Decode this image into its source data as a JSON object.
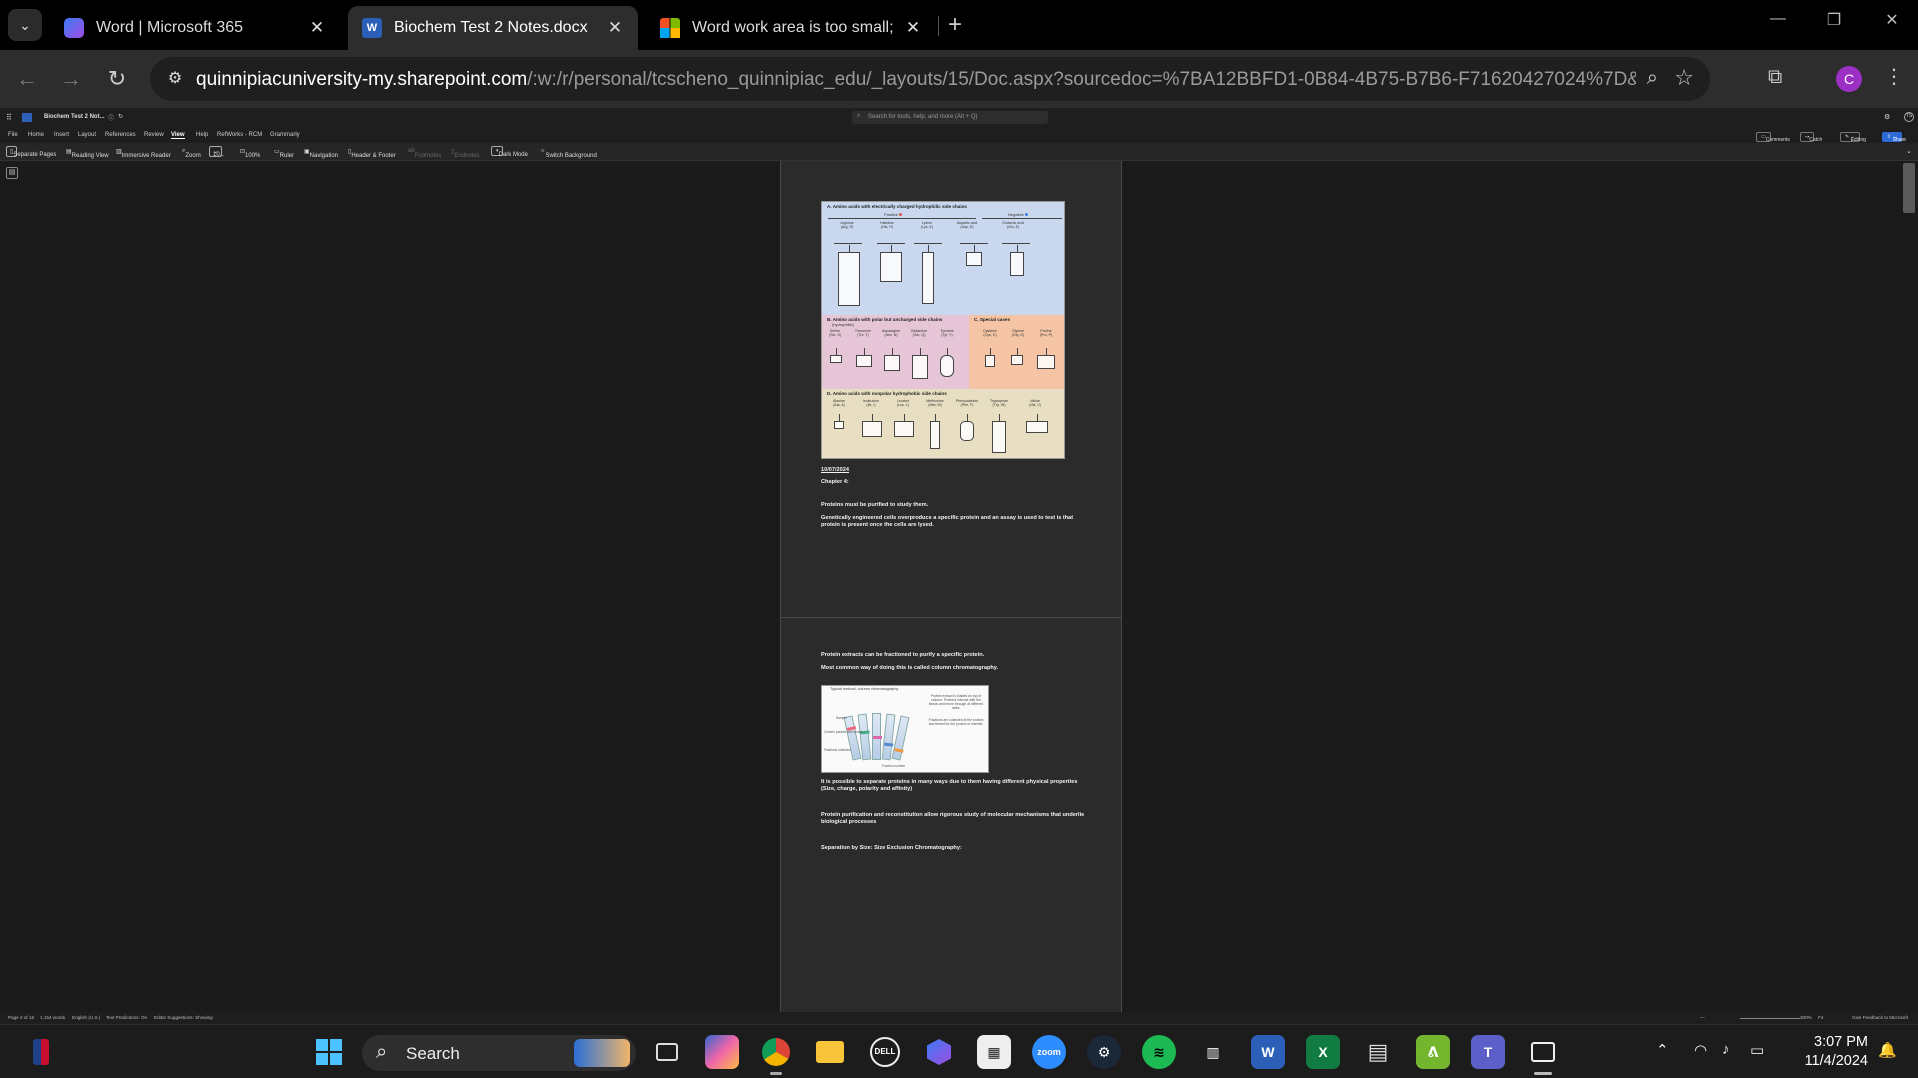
{
  "browser": {
    "tabs": [
      {
        "title": "Word | Microsoft 365",
        "active": false
      },
      {
        "title": "Biochem Test 2 Notes.docx",
        "active": true
      },
      {
        "title": "Word work area is too small; ho",
        "active": false
      }
    ],
    "url_host": "quinnipiacuniversity-my.sharepoint.com",
    "url_path": "/:w:/r/personal/tcscheno_quinnipiac_edu/_layouts/15/Doc.aspx?sourcedoc=%7BA12BBFD1-0B84-4B75-B7B6-F71620427024%7D&file=Biochem%2...",
    "profile_initial": "C"
  },
  "word": {
    "doc_name": "Biochem Test 2 Not...",
    "search_placeholder": "Search for tools, help, and more (Alt + Q)",
    "menu": [
      "File",
      "Home",
      "Insert",
      "Layout",
      "References",
      "Review",
      "View",
      "Help",
      "RefWorks - RCM",
      "Grammarly"
    ],
    "active_menu": "View",
    "right_buttons": {
      "comments": "Comments",
      "catchup": "Catch up",
      "editing": "Editing",
      "share": "Share"
    },
    "ribbon": {
      "separate_pages": "Separate Pages",
      "reading_view": "Reading View",
      "immersive_reader": "Immersive Reader",
      "zoom": "Zoom",
      "zoom_value": "10...",
      "hundred": "100%",
      "ruler": "Ruler",
      "navigation": "Navigation",
      "header_footer": "Header & Footer",
      "footnotes": "Footnotes",
      "endnotes": "Endnotes",
      "dark_mode": "Dark Mode",
      "switch_background": "Switch Background"
    },
    "status": {
      "page": "Page 2 of 18",
      "words": "1,154 words",
      "language": "English (U.S.)",
      "predictions": "Text Predictions: On",
      "editor": "Editor Suggestions: Showing",
      "zoom": "300%",
      "fit": "Fit",
      "feedback": "Give Feedback to Microsoft"
    }
  },
  "document": {
    "figure1": {
      "sectionA": "A.  Amino acids with electrically charged hydrophilic side chains",
      "positive": "Positive",
      "negative": "Negative",
      "charged": [
        "Arginine\n(Arg, R)",
        "Histidine\n(His, H)",
        "Lysine\n(Lys, K)",
        "Aspartic acid\n(Asp, D)",
        "Glutamic acid\n(Glu, E)"
      ],
      "sectionB": "B.  Amino acids with polar but uncharged side chains",
      "sectionB_sub": "(hydrophilic)",
      "polar": [
        "Serine\n(Ser, S)",
        "Threonine\n(Thr, T)",
        "Asparagine\n(Asn, N)",
        "Glutamine\n(Gln, Q)",
        "Tyrosine\n(Tyr, Y)"
      ],
      "sectionC": "C.  Special cases",
      "special": [
        "Cysteine\n(Cys, C)",
        "Glycine\n(Gly, G)",
        "Proline\n(Pro, P)"
      ],
      "sectionD": "D.  Amino acids with nonpolar hydrophobic side chains",
      "nonpolar": [
        "Alanine\n(Ala, A)",
        "Isoleucine\n(Ile, I)",
        "Leucine\n(Leu, L)",
        "Methionine\n(Met, M)",
        "Phenylalanine\n(Phe, F)",
        "Tryptophan\n(Trp, W)",
        "Valine\n(Val, V)"
      ]
    },
    "date": "10/07/2024",
    "chapter": "Chapter 4:",
    "p1": "Proteins must be purified to study them.",
    "p2": "Genetically engineered cells overproduce a specific protein and an assay is used to test is that protein is present once the cells are lysed.",
    "p3": "Protein extracts can be fractioned to purify a specific protein.",
    "p4": "Most common way of doing this is called column chromatography.",
    "figure2": {
      "caption": "Typical method: column chromatography",
      "note1": "Protein extract is loaded on top of column. Proteins interact with the beads and move through at different rates.",
      "note2": "Fractions are collected at the bottom and tested for the protein of interest.",
      "labels": [
        "Sample",
        "Column packed with beads",
        "Fractions collected",
        "Fraction number"
      ]
    },
    "p5": "It is possible to separate proteins in many ways due to them having different physical properties (Size, charge, polarity and affinity)",
    "p6": "Protein purification and reconstitution allow rigorous study of molecular mechanisms that underlie biological processes",
    "p7": "Separation by Size: Size Exclusion Chromatography:"
  },
  "taskbar": {
    "search_label": "Search",
    "time": "3:07 PM",
    "date": "11/4/2024",
    "apps": [
      "nba-app",
      "windows-start",
      "task-view",
      "copilot",
      "chrome",
      "file-explorer",
      "dell",
      "m365",
      "minecraft",
      "zoom",
      "steam",
      "spotify",
      "mixer",
      "word",
      "excel",
      "notepad",
      "alienware",
      "teams",
      "snipping-tool"
    ]
  },
  "colors": {
    "accent_blue": "#2f6bd6",
    "section_a_bg": "#c9d8ef",
    "section_b_bg": "#e6c6d6",
    "section_c_bg": "#f4c4a4",
    "section_d_bg": "#e8dfc2",
    "positive_dot": "#d9534f",
    "negative_dot": "#3f7fd9"
  }
}
